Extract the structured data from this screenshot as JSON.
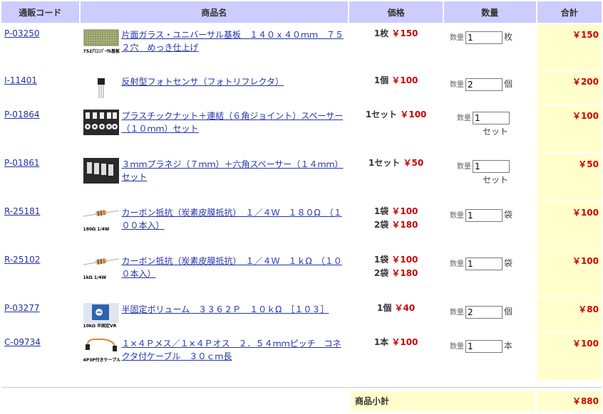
{
  "headers": {
    "code": "通販コード",
    "name": "商品名",
    "price": "価格",
    "qty": "数量",
    "total": "合計"
  },
  "qty_label": "数量",
  "items": [
    {
      "code": "P-03250",
      "name": "片面ガラス・ユニバーサル基板　１４０ｘ４０ｍｍ　７５２穴　めっき仕上げ",
      "thumb_caption": "752穴ﾕﾆﾊﾞｰｻﾙ基板",
      "thumb_icon": "pcb-board-icon",
      "prices": [
        {
          "unit": "1枚",
          "price": "￥150"
        }
      ],
      "qty": "1",
      "qty_unit": "枚",
      "total": "￥150"
    },
    {
      "code": "I-11401",
      "name": "反射型フォトセンサ（フォトリフレクタ）",
      "thumb_caption": "",
      "thumb_icon": "photo-sensor-icon",
      "prices": [
        {
          "unit": "1個",
          "price": "￥100"
        }
      ],
      "qty": "2",
      "qty_unit": "個",
      "total": "￥200"
    },
    {
      "code": "P-01864",
      "name": "プラスチックナット＋連結（６角ジョイント）スペーサー（１０ｍｍ）セット",
      "thumb_caption": "",
      "thumb_icon": "plastic-spacer-icon",
      "prices": [
        {
          "unit": "1セット",
          "price": "￥100"
        }
      ],
      "qty": "1",
      "qty_unit": "セット",
      "total": "￥100"
    },
    {
      "code": "P-01861",
      "name": "３ｍｍプラネジ（７ｍｍ）＋六角スペーサー（１４ｍｍ）セット",
      "thumb_caption": "",
      "thumb_icon": "plastic-screw-icon",
      "prices": [
        {
          "unit": "1セット",
          "price": "￥50"
        }
      ],
      "qty": "1",
      "qty_unit": "セット",
      "total": "￥50"
    },
    {
      "code": "R-25181",
      "name": "カーボン抵抗（炭素皮膜抵抗）　１／４Ｗ　１８０Ω　（１００本入）",
      "thumb_caption": "180Ω 1/4W",
      "thumb_icon": "resistor-icon",
      "prices": [
        {
          "unit": "1袋",
          "price": "￥100"
        },
        {
          "unit": "2袋",
          "price": "￥180"
        }
      ],
      "qty": "1",
      "qty_unit": "袋",
      "total": "￥100"
    },
    {
      "code": "R-25102",
      "name": "カーボン抵抗（炭素皮膜抵抗）　１／４Ｗ　１ｋΩ　（１００本入）",
      "thumb_caption": "1kΩ 1/4W",
      "thumb_icon": "resistor-icon",
      "prices": [
        {
          "unit": "1袋",
          "price": "￥100"
        },
        {
          "unit": "2袋",
          "price": "￥180"
        }
      ],
      "qty": "1",
      "qty_unit": "袋",
      "total": "￥100"
    },
    {
      "code": "P-03277",
      "name": "半固定ボリューム　３３６２Ｐ　１０ｋΩ　［１０３］",
      "thumb_caption": "10kΩ 半固定VR",
      "thumb_icon": "trimmer-potentiometer-icon",
      "prices": [
        {
          "unit": "1個",
          "price": "￥40"
        }
      ],
      "qty": "2",
      "qty_unit": "個",
      "total": "￥80"
    },
    {
      "code": "C-09734",
      "name": "１×４Ｐメス／１×４Ｐオス　２．５４ｍｍピッチ　コネクタ付ケーブル　３０ｃｍ長",
      "thumb_caption": "4P3P付きケーブル",
      "thumb_icon": "connector-cable-icon",
      "prices": [
        {
          "unit": "1本",
          "price": "￥100"
        }
      ],
      "qty": "1",
      "qty_unit": "本",
      "total": "￥100"
    }
  ],
  "subtotal": {
    "label": "商品小計",
    "value": "￥880"
  }
}
